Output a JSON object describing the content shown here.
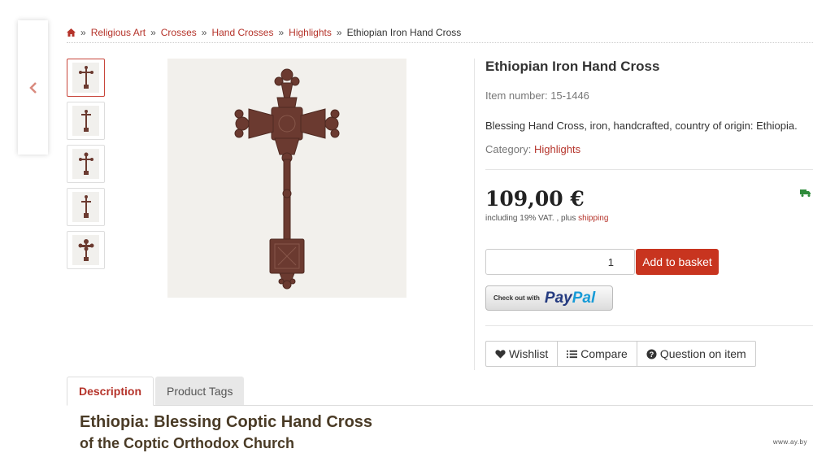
{
  "breadcrumb": {
    "items": [
      "Religious Art",
      "Crosses",
      "Hand Crosses",
      "Highlights"
    ],
    "separator": "»",
    "current": "Ethiopian Iron Hand Cross"
  },
  "product": {
    "title": "Ethiopian Iron Hand Cross",
    "item_number": "Item number: 15-1446",
    "short_description": "Blessing Hand Cross, iron, handcrafted, country of origin: Ethiopia.",
    "category_label": "Category: ",
    "category_value": "Highlights",
    "price": "109,00 €",
    "vat_text": "including 19% VAT. , plus ",
    "shipping_link": "shipping",
    "quantity": "1",
    "add_to_basket": "Add to basket",
    "paypal_prefix": "Check out with",
    "paypal_brand_1": "Pay",
    "paypal_brand_2": "Pal"
  },
  "actions": {
    "wishlist": "Wishlist",
    "compare": "Compare",
    "question": "Question on item"
  },
  "tabs": {
    "description": "Description",
    "product_tags": "Product Tags"
  },
  "description": {
    "heading": "Ethiopia: Blessing Coptic Hand Cross",
    "subheading": "of the Coptic Orthodox Church"
  },
  "watermark": "www.ay.by",
  "colors": {
    "accent": "#b5332a",
    "button": "#c8341f",
    "cross": "#6b3a30",
    "truck": "#2e8b3a"
  },
  "icons": [
    "home-icon",
    "chevron-left-icon",
    "heart-icon",
    "compare-icon",
    "question-icon",
    "truck-icon"
  ]
}
